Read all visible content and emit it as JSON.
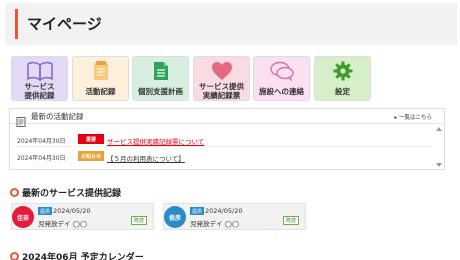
{
  "header": {
    "title": "マイページ"
  },
  "menu": [
    {
      "label": "サービス\n提供記録",
      "icon": "book-icon"
    },
    {
      "label": "活動記録",
      "icon": "notepad-icon"
    },
    {
      "label": "個別支援計画",
      "icon": "document-icon"
    },
    {
      "label": "サービス提供\n実績記録票",
      "icon": "heart-icon"
    },
    {
      "label": "施設への連絡",
      "icon": "chat-bubbles-icon"
    },
    {
      "label": "設定",
      "icon": "gear-icon"
    }
  ],
  "activity": {
    "title": "最新の活動記録",
    "more": "▸ 一覧はこちら",
    "rows": [
      {
        "date": "2024年04月30日",
        "badge": "重要",
        "text": "サービス提供実績記録票について"
      },
      {
        "date": "2024年04月30日",
        "badge": "お知らせ",
        "text": "【５月の利用表について】"
      }
    ]
  },
  "records": {
    "title": "最新のサービス提供記録",
    "items": [
      {
        "person": "佳奈",
        "tag": "提供",
        "date": "2024/05/20",
        "service": "児発放デイ ◯◯",
        "status": "既読"
      },
      {
        "person": "俊彦",
        "tag": "提供",
        "date": "2024/05/20",
        "service": "児発放デイ ◯◯",
        "status": "既読"
      }
    ]
  },
  "calendar": {
    "title": "2024年06月 予定カレンダー"
  },
  "colors": {
    "accent": "#e8563d",
    "important": "#e60012",
    "notice": "#e9a23b",
    "tag_blue": "#2a8cc7"
  }
}
